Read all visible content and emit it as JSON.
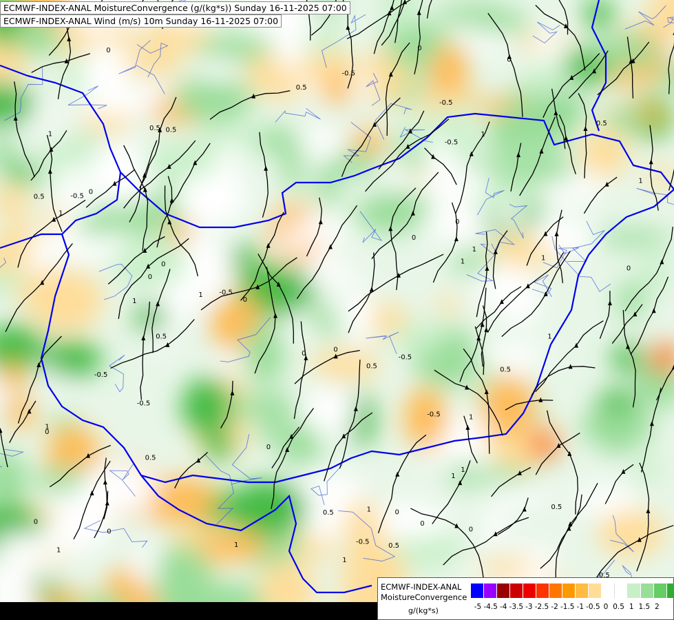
{
  "titles": {
    "line1": "ECMWF-INDEX-ANAL MoistureConvergence (g/(kg*s)) Sunday 16-11-2025 07:00",
    "line2": "ECMWF-INDEX-ANAL Wind (m/s) 10m Sunday 16-11-2025 07:00"
  },
  "legend": {
    "name_line1": "ECMWF-INDEX-ANAL",
    "name_line2": "MoistureConvergence",
    "unit": "g/(kg*s)",
    "colors": [
      "#0000ff",
      "#9900ff",
      "#990000",
      "#cc0000",
      "#ee0000",
      "#ff3300",
      "#ff7700",
      "#ff9900",
      "#ffbb44",
      "#ffdd99",
      "#ffffff",
      "#ffffff",
      "#c8f0c8",
      "#99dd99",
      "#66cc66",
      "#33aa33",
      "#009900"
    ],
    "ticks": [
      "-5",
      "-4.5",
      "-4",
      "-3.5",
      "-3",
      "-2.5",
      "-2",
      "-1.5",
      "-1",
      "-0.5",
      "0",
      "0.5",
      "1",
      "1.5",
      "2"
    ]
  },
  "map": {
    "contour_labels": [
      "0",
      "-0.5",
      "0.5",
      "1"
    ],
    "colors": {
      "border": "#0000ee",
      "river": "#3355dd",
      "streamline": "#000000",
      "green_light": "#c8f0c8",
      "green_mid": "#99dd99",
      "green_dark": "#44bb44",
      "orange_light": "#ffdd99",
      "orange_mid": "#ffbb55",
      "orange_dark": "#ff7700",
      "background": "#ffffff"
    }
  }
}
